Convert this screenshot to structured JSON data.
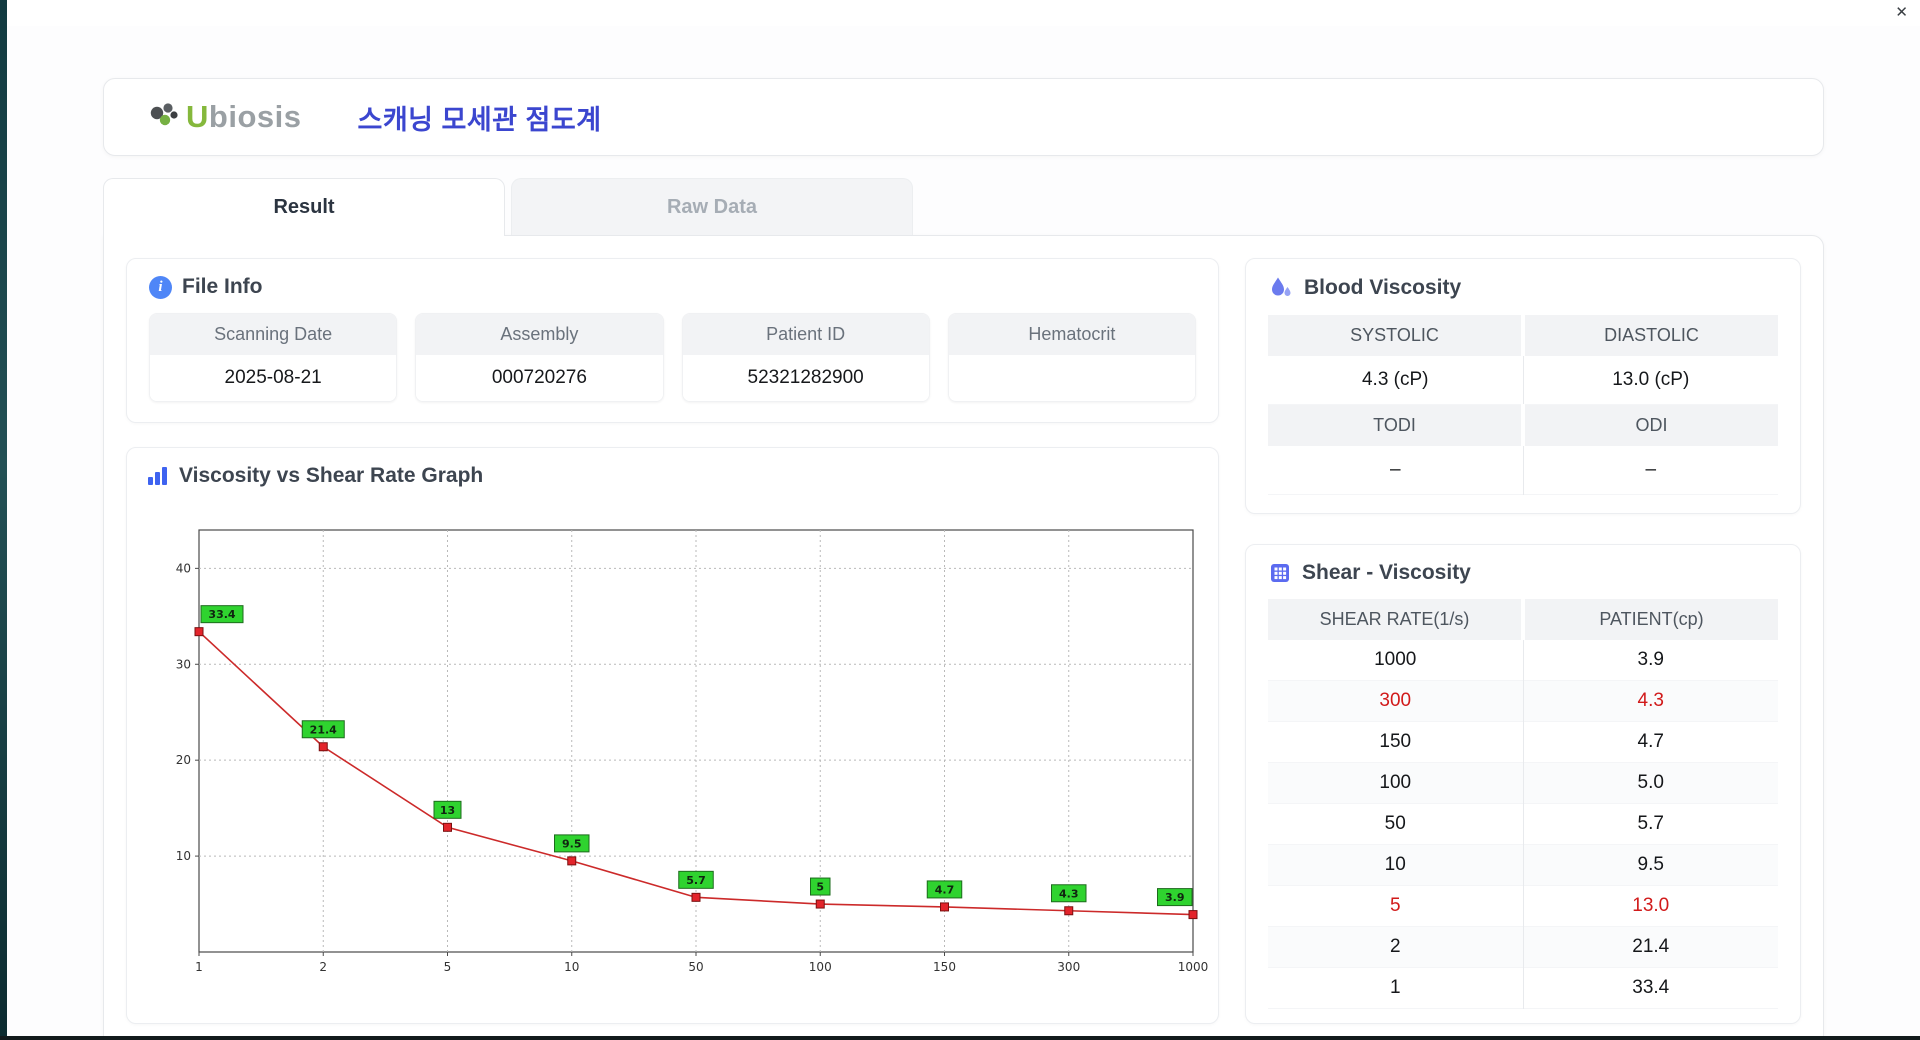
{
  "window": {
    "close_glyph": "✕"
  },
  "header": {
    "logo_accent": "U",
    "logo_rest": "biosis",
    "title": "스캐닝 모세관 점도계"
  },
  "tabs": [
    {
      "label": "Result",
      "active": true
    },
    {
      "label": "Raw Data",
      "active": false
    }
  ],
  "file_info": {
    "title": "File Info",
    "fields": [
      {
        "key": "scanning-date",
        "label": "Scanning Date",
        "value": "2025-08-21"
      },
      {
        "key": "assembly",
        "label": "Assembly",
        "value": "000720276"
      },
      {
        "key": "patient-id",
        "label": "Patient ID",
        "value": "52321282900"
      },
      {
        "key": "hematocrit",
        "label": "Hematocrit",
        "value": ""
      }
    ]
  },
  "blood_viscosity": {
    "title": "Blood Viscosity",
    "sections": [
      {
        "headers": [
          "SYSTOLIC",
          "DIASTOLIC"
        ],
        "values": [
          "4.3 (cP)",
          "13.0 (cP)"
        ]
      },
      {
        "headers": [
          "TODI",
          "ODI"
        ],
        "values": [
          "–",
          "–"
        ]
      }
    ]
  },
  "shear_viscosity": {
    "title": "Shear - Viscosity",
    "columns": [
      "SHEAR RATE(1/s)",
      "PATIENT(cp)"
    ],
    "rows": [
      {
        "shear": "1000",
        "patient": "3.9",
        "highlight": false
      },
      {
        "shear": "300",
        "patient": "4.3",
        "highlight": true
      },
      {
        "shear": "150",
        "patient": "4.7",
        "highlight": false
      },
      {
        "shear": "100",
        "patient": "5.0",
        "highlight": false
      },
      {
        "shear": "50",
        "patient": "5.7",
        "highlight": false
      },
      {
        "shear": "10",
        "patient": "9.5",
        "highlight": false
      },
      {
        "shear": "5",
        "patient": "13.0",
        "highlight": true
      },
      {
        "shear": "2",
        "patient": "21.4",
        "highlight": false
      },
      {
        "shear": "1",
        "patient": "33.4",
        "highlight": false
      }
    ]
  },
  "chart": {
    "title": "Viscosity vs Shear Rate Graph"
  },
  "chart_data": {
    "type": "line",
    "title": "Viscosity vs Shear Rate Graph",
    "x": [
      1,
      2,
      5,
      10,
      50,
      100,
      150,
      300,
      1000
    ],
    "x_tick_labels": [
      "1",
      "2",
      "5",
      "10",
      "50",
      "100",
      "150",
      "300",
      "1000"
    ],
    "values": [
      33.4,
      21.4,
      13,
      9.5,
      5.7,
      5,
      4.7,
      4.3,
      3.9
    ],
    "point_labels": [
      "33.4",
      "21.4",
      "13",
      "9.5",
      "5.7",
      "5",
      "4.7",
      "4.3",
      "3.9"
    ],
    "y_ticks": [
      10,
      20,
      30,
      40
    ],
    "ylim": [
      0,
      44
    ],
    "x_scale": "categorical (log-spaced ticks)",
    "grid": true,
    "line_color": "#cc2a2a",
    "marker_color": "#e3242b",
    "marker_edge": "#7a1010",
    "label_bg": "#2fd32f",
    "label_edge": "#1d6b1d"
  }
}
